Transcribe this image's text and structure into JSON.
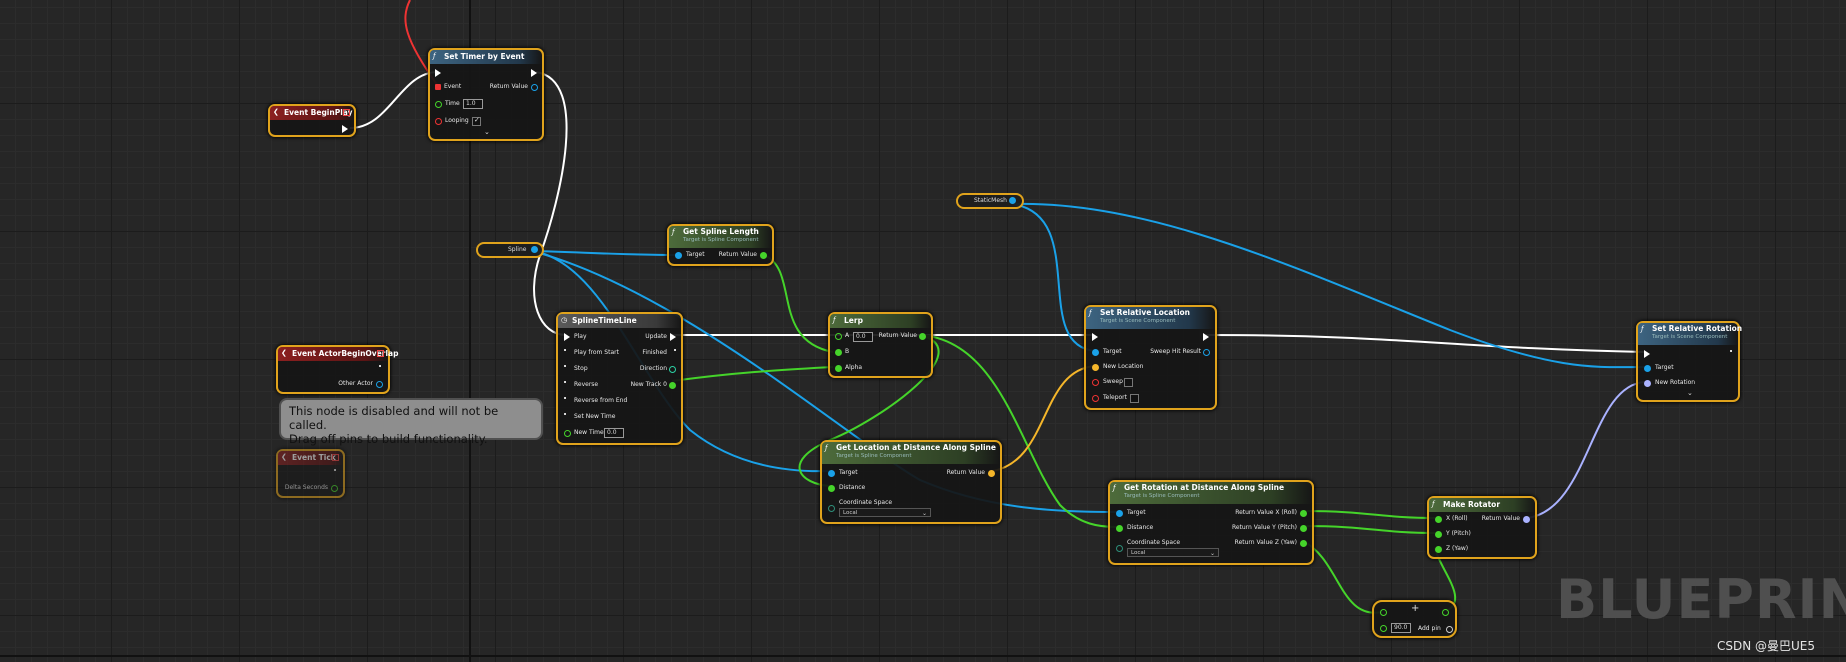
{
  "nodes": {
    "set_timer": {
      "title": "Set Timer by Event",
      "event": "Event",
      "return_value": "Return Value",
      "time": "Time",
      "time_value": "1.0",
      "looping": "Looping"
    },
    "event_begin_play": {
      "title": "Event BeginPlay"
    },
    "spline_var": {
      "label": "Spline"
    },
    "static_mesh_var": {
      "label": "StaticMesh"
    },
    "get_spline_length": {
      "title": "Get Spline Length",
      "subtitle": "Target is Spline Component",
      "target": "Target",
      "return_value": "Return Value"
    },
    "timeline": {
      "title": "SplineTimeLine",
      "inputs": [
        "Play",
        "Play from Start",
        "Stop",
        "Reverse",
        "Reverse from End",
        "Set New Time",
        "New Time"
      ],
      "outputs": [
        "Update",
        "Finished",
        "Direction",
        "New Track 0"
      ],
      "new_time_value": "0.0"
    },
    "lerp": {
      "title": "Lerp",
      "a": "A",
      "a_value": "0.0",
      "b": "B",
      "alpha": "Alpha",
      "return_value": "Return Value"
    },
    "set_rel_loc": {
      "title": "Set Relative Location",
      "subtitle": "Target is Scene Component",
      "target": "Target",
      "new_location": "New Location",
      "sweep": "Sweep",
      "teleport": "Teleport",
      "sweep_hit": "Sweep Hit Result"
    },
    "set_rel_rot": {
      "title": "Set Relative Rotation",
      "subtitle": "Target is Scene Component",
      "target": "Target",
      "new_rotation": "New Rotation"
    },
    "event_overlap": {
      "title": "Event ActorBeginOverlap",
      "other_actor": "Other Actor"
    },
    "event_tick": {
      "title": "Event Tick",
      "delta": "Delta Seconds"
    },
    "get_loc_dist": {
      "title": "Get Location at Distance Along Spline",
      "subtitle": "Target is Spline Component",
      "target": "Target",
      "distance": "Distance",
      "coord_space": "Coordinate Space",
      "coord_value": "Local",
      "return_value": "Return Value"
    },
    "get_rot_dist": {
      "title": "Get Rotation at Distance Along Spline",
      "subtitle": "Target is Spline Component",
      "target": "Target",
      "distance": "Distance",
      "coord_space": "Coordinate Space",
      "coord_value": "Local",
      "rx": "Return Value X (Roll)",
      "ry": "Return Value Y (Pitch)",
      "rz": "Return Value Z (Yaw)"
    },
    "make_rotator": {
      "title": "Make Rotator",
      "x": "X (Roll)",
      "y": "Y (Pitch)",
      "z": "Z (Yaw)",
      "return_value": "Return Value"
    },
    "add_node": {
      "value": "90.0",
      "add_pin": "Add pin",
      "plus": "+"
    }
  },
  "tooltip": {
    "line1": "This node is disabled and will not be called.",
    "line2": "Drag off pins to build functionality."
  },
  "watermark": "BLUEPRINT",
  "credit": "CSDN @曼巴UE5",
  "colors": {
    "exec_wire": "#ffffff",
    "object_wire": "#1aa1e8",
    "float_wire": "#45d42a",
    "vector_wire": "#f5b62a",
    "rotator_wire": "#aab2ff",
    "delegate_wire": "#e33333",
    "node_border_selected": "#e0a31c"
  }
}
